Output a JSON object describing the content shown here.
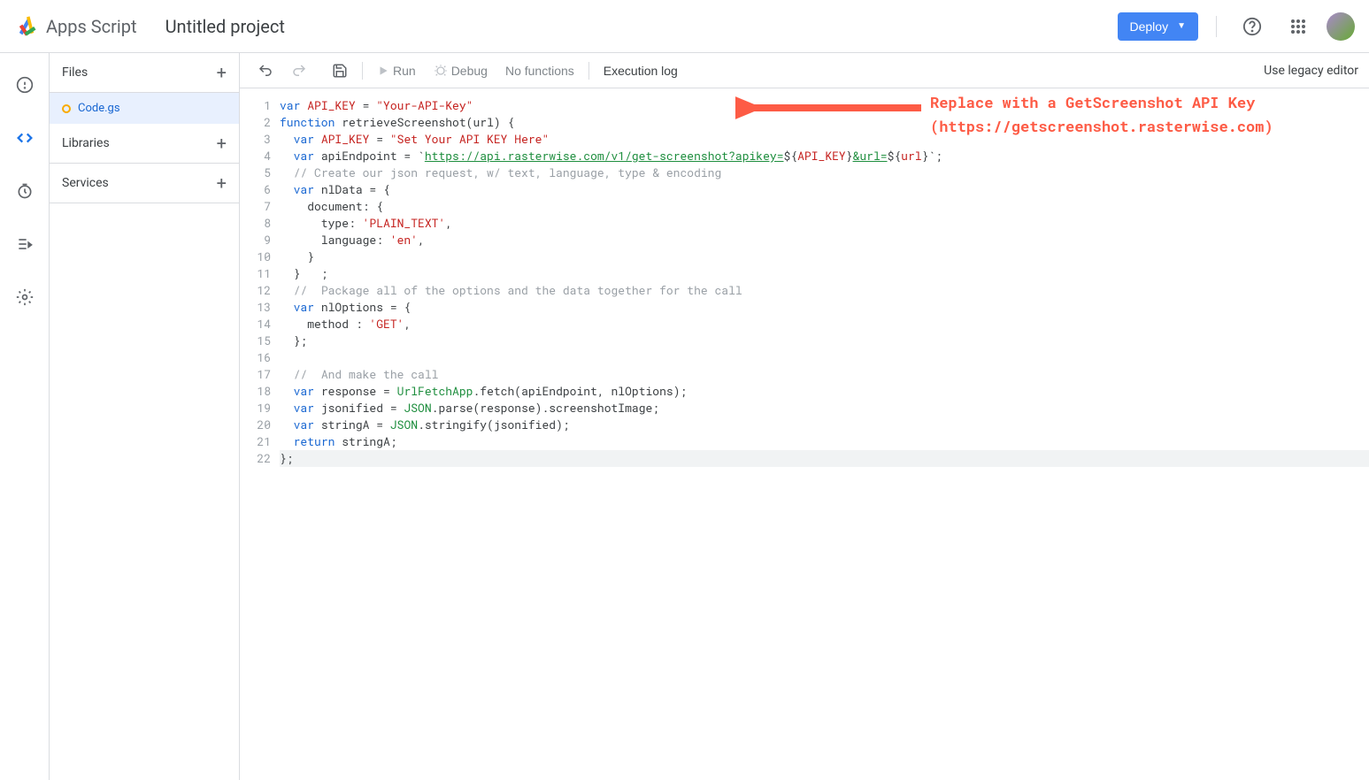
{
  "header": {
    "app_name": "Apps Script",
    "project_title": "Untitled project",
    "deploy_label": "Deploy",
    "legacy_link": "Use legacy editor"
  },
  "sidebar": {
    "files_label": "Files",
    "libraries_label": "Libraries",
    "services_label": "Services",
    "file_name": "Code.gs"
  },
  "toolbar": {
    "run_label": "Run",
    "debug_label": "Debug",
    "no_functions": "No functions",
    "execution_log": "Execution log"
  },
  "annotation": {
    "line1": "Replace with a GetScreenshot API Key",
    "line2": "(https://getscreenshot.rasterwise.com)"
  },
  "code": {
    "line_count": 22,
    "lines": [
      {
        "n": 1,
        "tokens": [
          [
            "kw",
            "var"
          ],
          [
            "",
            " "
          ],
          [
            "id",
            "API_KEY"
          ],
          [
            "",
            " = "
          ],
          [
            "str",
            "\"Your-API-Key\""
          ]
        ]
      },
      {
        "n": 2,
        "tokens": [
          [
            "kw",
            "function"
          ],
          [
            "",
            " "
          ],
          [
            "fn",
            "retrieveScreenshot"
          ],
          [
            "",
            "(url) {"
          ]
        ]
      },
      {
        "n": 3,
        "tokens": [
          [
            "",
            "  "
          ],
          [
            "kw",
            "var"
          ],
          [
            "",
            " "
          ],
          [
            "id",
            "API_KEY"
          ],
          [
            "",
            " = "
          ],
          [
            "str",
            "\"Set Your API KEY Here\""
          ]
        ]
      },
      {
        "n": 4,
        "tokens": [
          [
            "",
            "  "
          ],
          [
            "kw",
            "var"
          ],
          [
            "",
            " apiEndpoint = `"
          ],
          [
            "url",
            "https://api.rasterwise.com/v1/get-screenshot?apikey="
          ],
          [
            "",
            "${"
          ],
          [
            "id",
            "API_KEY"
          ],
          [
            "",
            "}"
          ],
          [
            "url",
            "&url="
          ],
          [
            "",
            "${"
          ],
          [
            "id",
            "url"
          ],
          [
            "",
            "}`;"
          ]
        ]
      },
      {
        "n": 5,
        "tokens": [
          [
            "",
            "  "
          ],
          [
            "cm",
            "// Create our json request, w/ text, language, type & encoding"
          ]
        ]
      },
      {
        "n": 6,
        "tokens": [
          [
            "",
            "  "
          ],
          [
            "kw",
            "var"
          ],
          [
            "",
            " nlData = {"
          ]
        ]
      },
      {
        "n": 7,
        "tokens": [
          [
            "",
            "    document: {"
          ]
        ]
      },
      {
        "n": 8,
        "tokens": [
          [
            "",
            "      type: "
          ],
          [
            "str",
            "'PLAIN_TEXT'"
          ],
          [
            "",
            ","
          ]
        ]
      },
      {
        "n": 9,
        "tokens": [
          [
            "",
            "      language: "
          ],
          [
            "str",
            "'en'"
          ],
          [
            "",
            ","
          ]
        ]
      },
      {
        "n": 10,
        "tokens": [
          [
            "",
            "    }"
          ]
        ]
      },
      {
        "n": 11,
        "tokens": [
          [
            "",
            "  }   ;"
          ]
        ]
      },
      {
        "n": 12,
        "tokens": [
          [
            "",
            "  "
          ],
          [
            "cm",
            "//  Package all of the options and the data together for the call"
          ]
        ]
      },
      {
        "n": 13,
        "tokens": [
          [
            "",
            "  "
          ],
          [
            "kw",
            "var"
          ],
          [
            "",
            " nlOptions = {"
          ]
        ]
      },
      {
        "n": 14,
        "tokens": [
          [
            "",
            "    method : "
          ],
          [
            "str",
            "'GET'"
          ],
          [
            "",
            ","
          ]
        ]
      },
      {
        "n": 15,
        "tokens": [
          [
            "",
            "  };"
          ]
        ]
      },
      {
        "n": 16,
        "tokens": [
          [
            "",
            ""
          ]
        ]
      },
      {
        "n": 17,
        "tokens": [
          [
            "",
            "  "
          ],
          [
            "cm",
            "//  And make the call"
          ]
        ]
      },
      {
        "n": 18,
        "tokens": [
          [
            "",
            "  "
          ],
          [
            "kw",
            "var"
          ],
          [
            "",
            " response = "
          ],
          [
            "gl",
            "UrlFetchApp"
          ],
          [
            "",
            ".fetch(apiEndpoint, nlOptions);"
          ]
        ]
      },
      {
        "n": 19,
        "tokens": [
          [
            "",
            "  "
          ],
          [
            "kw",
            "var"
          ],
          [
            "",
            " jsonified = "
          ],
          [
            "gl",
            "JSON"
          ],
          [
            "",
            ".parse(response).screenshotImage;"
          ]
        ]
      },
      {
        "n": 20,
        "tokens": [
          [
            "",
            "  "
          ],
          [
            "kw",
            "var"
          ],
          [
            "",
            " stringA = "
          ],
          [
            "gl",
            "JSON"
          ],
          [
            "",
            ".stringify(jsonified);"
          ]
        ]
      },
      {
        "n": 21,
        "tokens": [
          [
            "",
            "  "
          ],
          [
            "kw",
            "return"
          ],
          [
            "",
            " stringA;"
          ]
        ]
      },
      {
        "n": 22,
        "hl": true,
        "tokens": [
          [
            "",
            "};"
          ]
        ]
      }
    ]
  }
}
